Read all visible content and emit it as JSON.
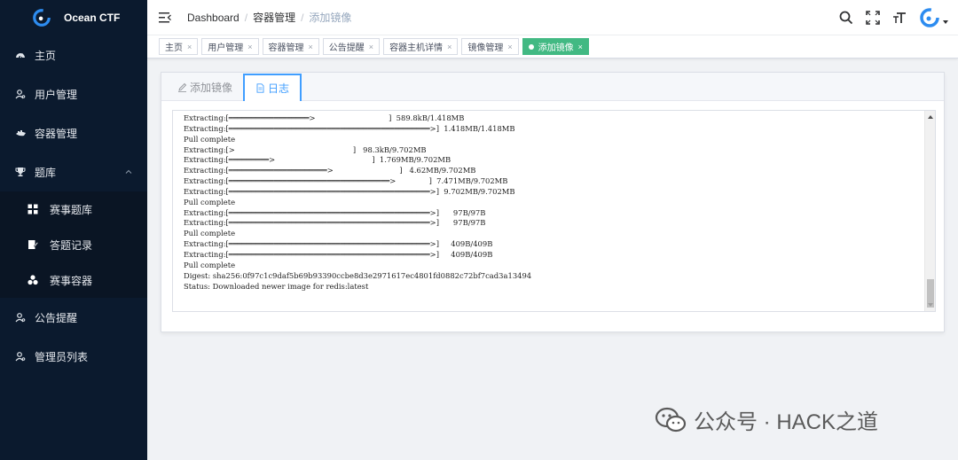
{
  "app": {
    "name": "Ocean CTF"
  },
  "sidebar": {
    "items": [
      {
        "label": "主页",
        "icon": "dashboard-icon"
      },
      {
        "label": "用户管理",
        "icon": "user-icon"
      },
      {
        "label": "容器管理",
        "icon": "container-icon"
      },
      {
        "label": "题库",
        "icon": "trophy-icon",
        "expanded": true
      },
      {
        "label": "公告提醒",
        "icon": "user-icon"
      },
      {
        "label": "管理员列表",
        "icon": "user-icon"
      }
    ],
    "subitems": [
      {
        "label": "赛事题库",
        "icon": "grid-icon"
      },
      {
        "label": "答题记录",
        "icon": "edit-doc-icon"
      },
      {
        "label": "赛事容器",
        "icon": "cluster-icon"
      }
    ]
  },
  "header": {
    "breadcrumb": [
      "Dashboard",
      "容器管理",
      "添加镜像"
    ],
    "separator": "/"
  },
  "tags": [
    {
      "label": "主页",
      "active": false
    },
    {
      "label": "用户管理",
      "active": false
    },
    {
      "label": "容器管理",
      "active": false
    },
    {
      "label": "公告提醒",
      "active": false
    },
    {
      "label": "容器主机详情",
      "active": false
    },
    {
      "label": "镜像管理",
      "active": false
    },
    {
      "label": "添加镜像",
      "active": true
    }
  ],
  "tag_close": "×",
  "main": {
    "tabs": [
      {
        "label": "添加镜像",
        "icon": "edit-icon",
        "active": false
      },
      {
        "label": "日志",
        "icon": "document-icon",
        "active": true
      }
    ],
    "log_lines": [
      "Extracting:[══════════════════>                               ]  589.8kB/1.418MB",
      "Extracting:[═════════════════════════════════════════════>]  1.418MB/1.418MB",
      "Pull complete",
      "Extracting:[>                                                  ]   98.3kB/9.702MB",
      "Extracting:[═════════>                                         ]  1.769MB/9.702MB",
      "Extracting:[══════════════════════>                            ]   4.62MB/9.702MB",
      "Extracting:[════════════════════════════════════>              ]  7.471MB/9.702MB",
      "Extracting:[═════════════════════════════════════════════>]  9.702MB/9.702MB",
      "Pull complete",
      "Extracting:[═════════════════════════════════════════════>]      97B/97B",
      "Extracting:[═════════════════════════════════════════════>]      97B/97B",
      "Pull complete",
      "Extracting:[═════════════════════════════════════════════>]     409B/409B",
      "Extracting:[═════════════════════════════════════════════>]     409B/409B",
      "Pull complete",
      "Digest: sha256:0f97c1c9daf5b69b93390ccbe8d3e2971617ec4801fd0882c72bf7cad3a13494",
      "Status: Downloaded newer image for redis:latest"
    ]
  },
  "watermark": {
    "text": "公众号 · HACK之道"
  },
  "colors": {
    "sidebar_bg": "#0b1a2e",
    "active_tag": "#42b983",
    "active_tab": "#409eff"
  }
}
